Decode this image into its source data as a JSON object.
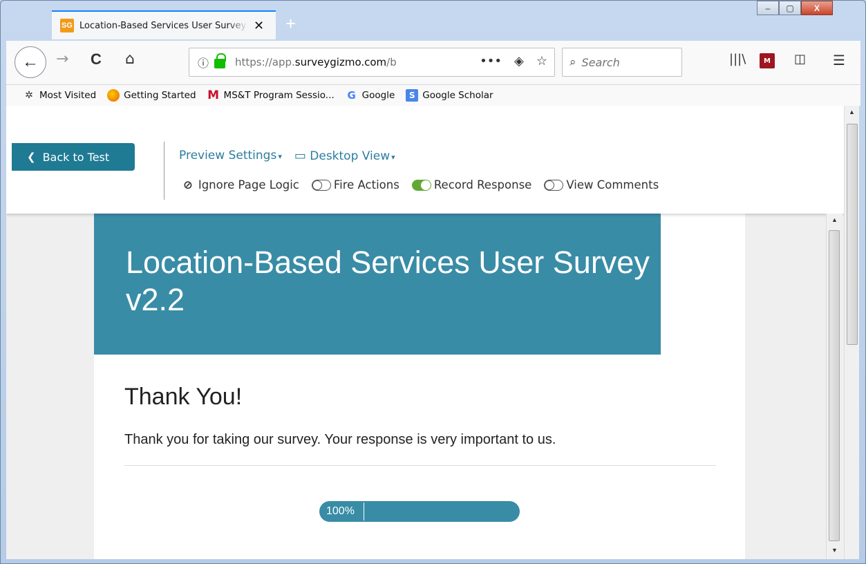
{
  "browser": {
    "tab": {
      "favicon_text": "SG",
      "title": "Location-Based Services User Survey"
    },
    "new_tab_symbol": "+",
    "window_controls": {
      "minimize": "–",
      "maximize": "▢",
      "close": "X"
    },
    "nav": {
      "back": "←",
      "forward": "→",
      "reload": "C",
      "home": "⌂"
    },
    "url": {
      "prefix": "https://app.",
      "domain": "surveygizmo.com",
      "suffix": "/b",
      "more": "•••",
      "pocket": "◈",
      "star": "☆"
    },
    "search": {
      "placeholder": "Search",
      "icon": "search-icon"
    },
    "toolbar_right": {
      "library": "|||\\",
      "mendeley": "M",
      "sidebar": "◫",
      "menu": "☰"
    },
    "bookmarks": [
      {
        "label": "Most Visited",
        "icon": "gear-icon",
        "symbol": "✲"
      },
      {
        "label": "Getting Started",
        "icon": "firefox-icon",
        "symbol": "●"
      },
      {
        "label": "MS&T Program Sessio...",
        "icon": "mst-icon",
        "symbol": "M"
      },
      {
        "label": "Google",
        "icon": "google-icon",
        "symbol": "G"
      },
      {
        "label": "Google Scholar",
        "icon": "scholar-icon",
        "symbol": "S"
      }
    ]
  },
  "preview": {
    "back_label": "Back to Test",
    "back_chevron": "❮",
    "settings_label": "Preview Settings",
    "view_label": "Desktop View",
    "caret": "▾",
    "monitor": "▭",
    "options": {
      "ignore_logic": "Ignore Page Logic",
      "fire_actions": "Fire Actions",
      "record_response": "Record Response",
      "view_comments": "View Comments",
      "ban_symbol": "⊘"
    }
  },
  "survey": {
    "title": "Location-Based Services User Survey v2.2",
    "heading": "Thank You!",
    "body": "Thank you for taking our survey. Your response is very important to us.",
    "progress_label": "100%",
    "progress_value": 100
  },
  "colors": {
    "header": "#398ca6",
    "back_button": "#1f7a93",
    "link": "#2b7d9e",
    "toggle_on": "#62a836"
  }
}
